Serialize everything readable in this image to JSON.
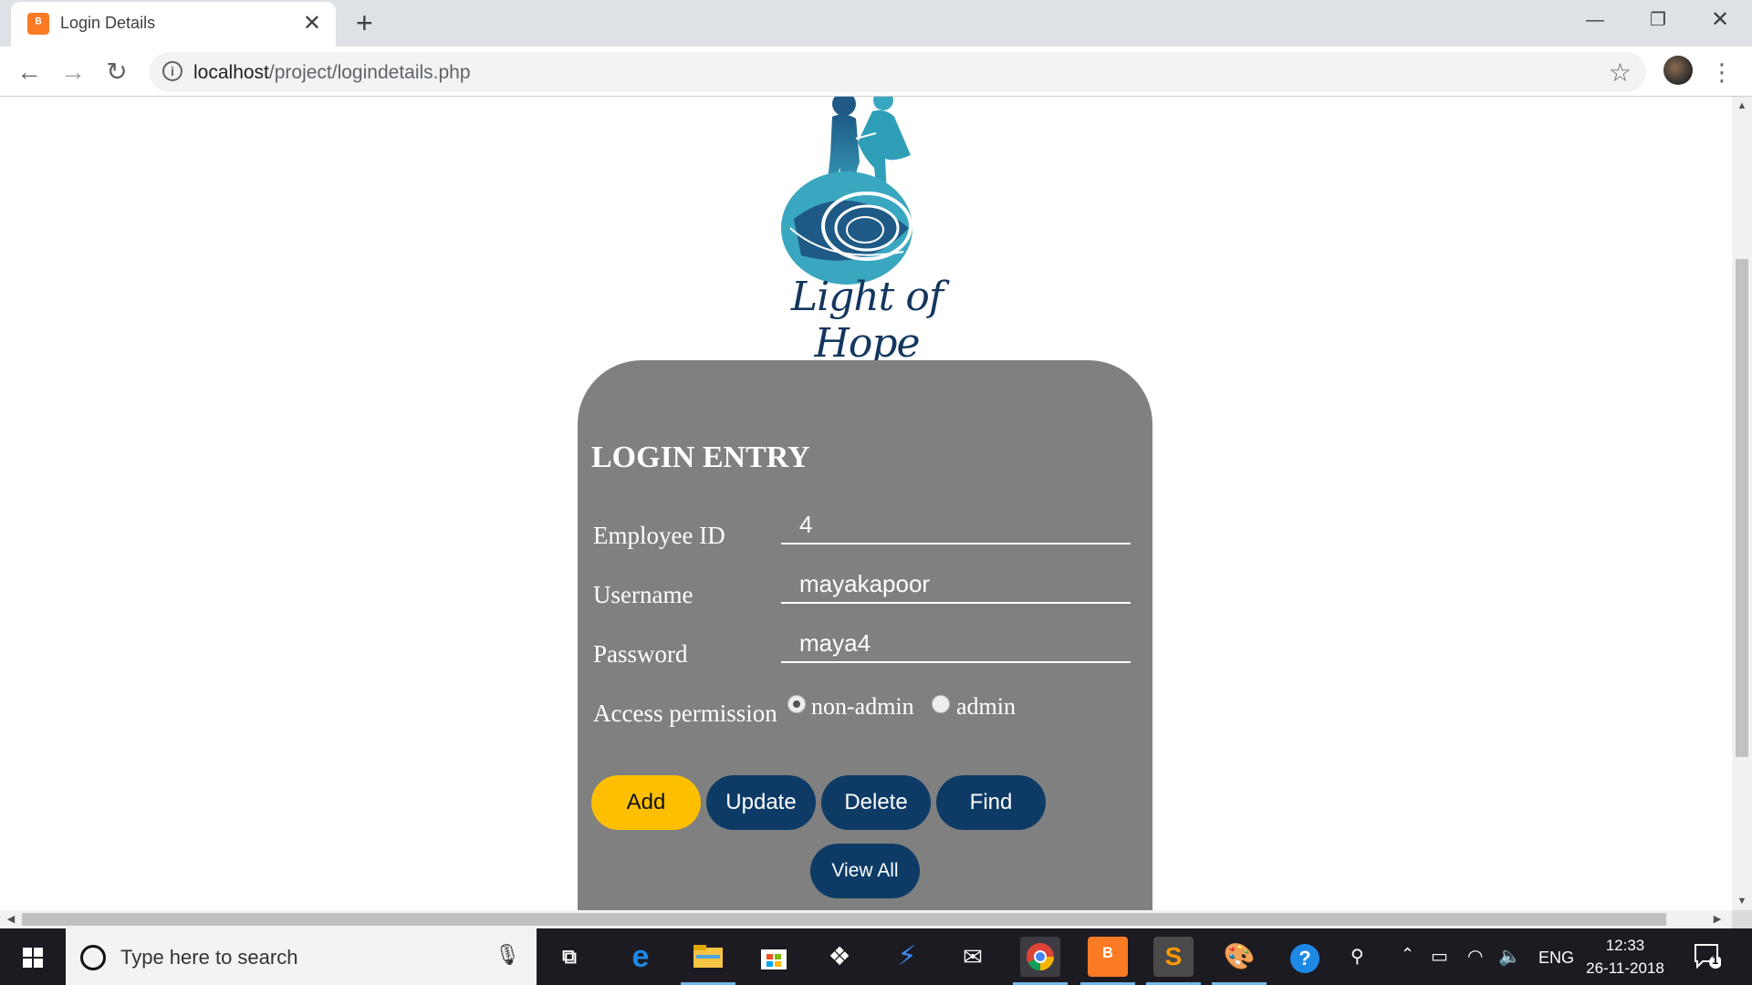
{
  "browser": {
    "tab_title": "Login Details",
    "tab_favicon": "xampp-icon",
    "url_host": "localhost",
    "url_path": "/project/logindetails.php",
    "close_tab_symbol": "✕",
    "new_tab_symbol": "+"
  },
  "logo": {
    "text": "Light of Hope",
    "colors": [
      "#13375e",
      "#3aa7c0"
    ]
  },
  "form": {
    "title": "LOGIN ENTRY",
    "fields": [
      {
        "label": "Employee ID",
        "value": "4"
      },
      {
        "label": "Username",
        "value": "mayakapoor"
      },
      {
        "label": "Password",
        "value": "maya4"
      }
    ],
    "access": {
      "label": "Access permission",
      "options": [
        "non-admin",
        "admin"
      ],
      "selected": "non-admin"
    },
    "buttons": [
      "Add",
      "Update",
      "Delete",
      "Find",
      "View All"
    ],
    "colors": {
      "card": "#808080",
      "primary": "#fdbf00",
      "secondary": "#0d3b66"
    }
  },
  "taskbar": {
    "search_placeholder": "Type here to search",
    "language": "ENG",
    "time": "12:33",
    "date": "26-11-2018",
    "notification_count": "1",
    "apps": [
      "task-view-icon",
      "edge-icon",
      "file-explorer-icon",
      "store-icon",
      "dropbox-icon",
      "visual-studio-icon",
      "mail-icon",
      "chrome-icon",
      "xampp-icon",
      "sublime-icon",
      "paint-icon",
      "help-icon",
      "people-icon"
    ]
  }
}
